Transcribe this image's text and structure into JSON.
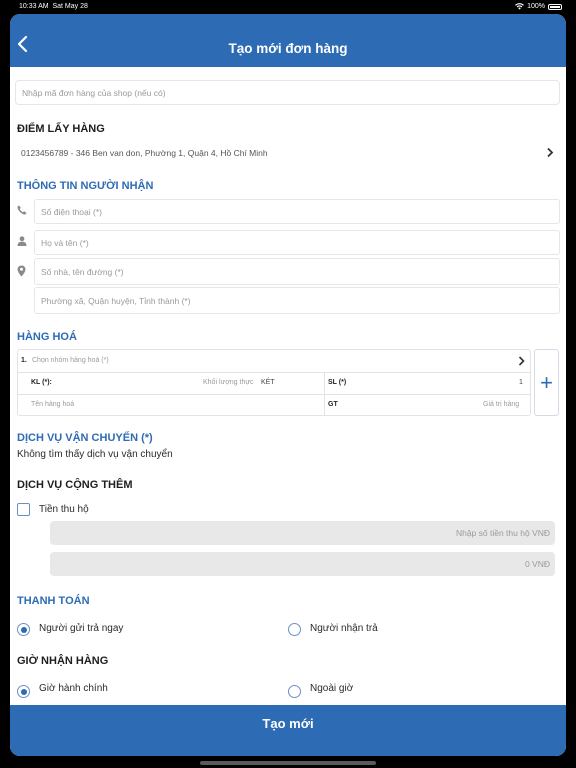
{
  "status_bar": {
    "time": "10:33 AM",
    "date": "Sat May 28",
    "battery": "100%"
  },
  "navbar": {
    "title": "Tạo mới đơn hàng",
    "back_icon": "chevron-left-icon"
  },
  "shop_code": {
    "placeholder": "Nhập mã đơn hàng của shop (nếu có)"
  },
  "pickup": {
    "heading": "ĐIỂM LẤY HÀNG",
    "address": "0123456789 - 346 Ben van don, Phường 1, Quận 4, Hồ Chí Minh"
  },
  "recipient": {
    "heading": "THÔNG TIN NGƯỜI NHẬN",
    "phone_placeholder": "Số điện thoại (*)",
    "name_placeholder": "Họ và tên (*)",
    "street_placeholder": "Số nhà, tên đường (*)",
    "area_placeholder": "Phường xã, Quận huyện, Tỉnh thành (*)"
  },
  "goods": {
    "heading": "HÀNG HOÁ",
    "index": "1.",
    "group_placeholder": "Chọn nhóm hàng hoá (*)",
    "weight_label": "KL (*):",
    "weight_placeholder": "Khối lượng thực",
    "weight_unit": "KÉT",
    "qty_label": "SL (*)",
    "qty_value": "1",
    "name_placeholder": "Tên hàng hoá",
    "value_label": "GT",
    "value_placeholder": "Giá trị hàng",
    "add_symbol": "+"
  },
  "shipping_service": {
    "heading": "DỊCH VỤ VẬN CHUYỂN (*)",
    "message": "Không tìm thấy dịch vụ vận chuyển"
  },
  "extra_service": {
    "heading": "DỊCH VỤ CỘNG THÊM",
    "cod_label": "Tiền thu hộ",
    "cod_placeholder": "Nhập số tiền thu hộ VNĐ",
    "cod_total": "0 VNĐ"
  },
  "payment": {
    "heading": "THANH TOÁN",
    "options": [
      {
        "label": "Người gửi trả ngay",
        "selected": true
      },
      {
        "label": "Người nhận trả",
        "selected": false
      }
    ]
  },
  "receive_time": {
    "heading": "GIỜ NHẬN HÀNG",
    "options": [
      {
        "label": "Giờ hành chính",
        "selected": true
      },
      {
        "label": "Ngoài giờ",
        "selected": false
      }
    ]
  },
  "submit": {
    "label": "Tạo mới"
  },
  "colors": {
    "primary": "#2e6bb5",
    "field_fill": "#e8e8e8"
  }
}
